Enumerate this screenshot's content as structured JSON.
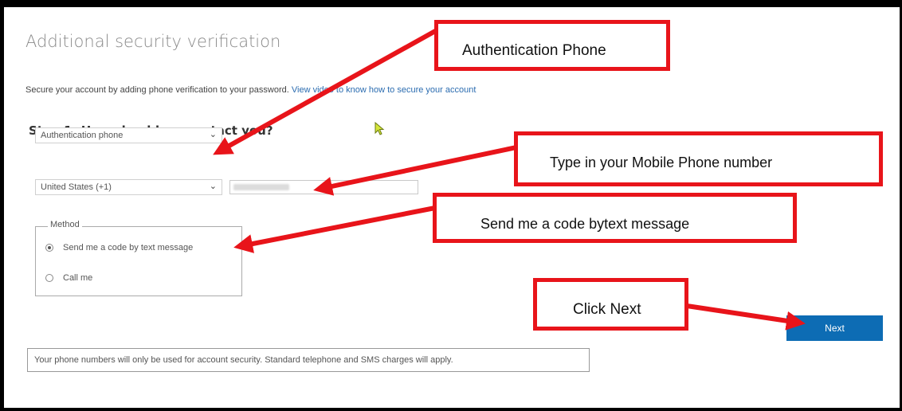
{
  "page": {
    "title": "Additional security verification",
    "subtitle_text": "Secure your account by adding phone verification to your password.",
    "subtitle_link": "View video to know how to secure your account",
    "step_heading": "Step 1: How should we contact you?",
    "contact_method_select": "Authentication phone",
    "country_select": "United States (+1)",
    "method_legend": "Method",
    "radio_options": [
      {
        "label": "Send me a code by text message",
        "selected": true
      },
      {
        "label": "Call me",
        "selected": false
      }
    ],
    "next_button": "Next",
    "notice": "Your phone numbers will only be used for account security. Standard telephone and SMS charges will apply."
  },
  "callouts": {
    "authentication_phone": "Authentication Phone",
    "mobile_number": "Type in your Mobile Phone number",
    "send_code": "Send me a code bytext message",
    "click_next": "Click Next"
  },
  "colors": {
    "callout_red": "#e8141a",
    "button_blue": "#0d6cb4",
    "link_blue": "#2b6cb0"
  }
}
